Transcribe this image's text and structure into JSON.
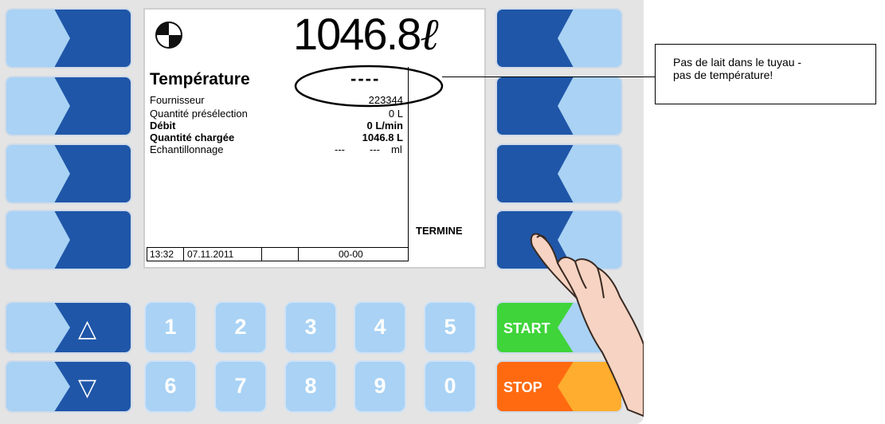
{
  "display": {
    "volume": "1046.8",
    "volume_unit": "ℓ",
    "title": "Température",
    "title_value": "----",
    "rows": [
      {
        "label": "Fournisseur",
        "value": "223344",
        "bold": false
      },
      {
        "label": "Quantité présélection",
        "value": "0 L",
        "bold": false
      },
      {
        "label": "Débit",
        "value": "0 L/min",
        "bold": true
      },
      {
        "label": "Quantité chargée",
        "value": "1046.8 L",
        "bold": true
      },
      {
        "label": "Echantillonnage",
        "value": "---",
        "value2": "---",
        "unit": "ml",
        "bold": false
      }
    ],
    "softkey_label": "TERMINE",
    "status_time": "13:32",
    "status_date": "07.11.2011",
    "status_code": "00-00"
  },
  "keypad": {
    "up_symbol": "△",
    "down_symbol": "▽",
    "digits_top": [
      "1",
      "2",
      "3",
      "4",
      "5"
    ],
    "digits_bottom": [
      "6",
      "7",
      "8",
      "9",
      "0"
    ],
    "start_label": "START",
    "stop_label": "STOP"
  },
  "callout": {
    "line1": "Pas de lait dans le tuyau -",
    "line2": "pas de température!"
  },
  "colors": {
    "key_dark": "#1f56a8",
    "key_light": "#a9d2f4",
    "start_green": "#3fd43a",
    "stop_orange": "#ff6a10",
    "stop_light": "#ffad2e"
  }
}
